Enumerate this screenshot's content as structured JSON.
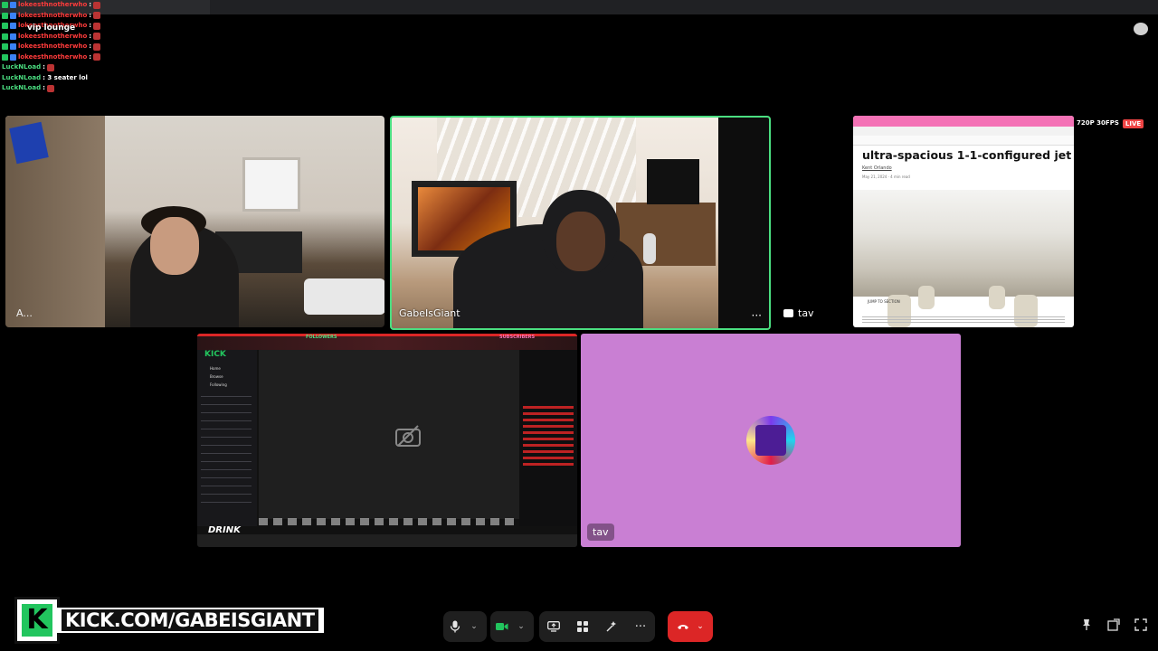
{
  "chat": {
    "lines": [
      {
        "user": "lokeesthnotherwho",
        "msg": ":"
      },
      {
        "user": "lokeesthnotherwho",
        "msg": ":"
      },
      {
        "user": "lokeesthnotherwho",
        "msg": ":"
      },
      {
        "user": "lokeesthnotherwho",
        "msg": ":"
      },
      {
        "user": "lokeesthnotherwho",
        "msg": ":"
      },
      {
        "user": "lokeesthnotherwho",
        "msg": ":"
      },
      {
        "user": "LuckNLoad",
        "msg": ":"
      },
      {
        "user": "LuckNLoad",
        "msg": ": 3 seater lol"
      },
      {
        "user": "LuckNLoad",
        "msg": ":"
      }
    ],
    "vip_label": "vip lounge"
  },
  "participants": {
    "tile_a": {
      "name": "A..."
    },
    "tile_b": {
      "name": "GabeIsGiant",
      "more": "···"
    },
    "tav_side": {
      "name": "tav"
    },
    "tile_e": {
      "name": "tav"
    }
  },
  "screenshare_article": {
    "headline": "ultra-spacious 1-1-configured jet",
    "author": "Kent Orlando",
    "date": "May 21, 2024 · 4 min read",
    "jump": "JUMP TO SECTION"
  },
  "stream_badges": {
    "resolution": "720P 30FPS",
    "live": "LIVE"
  },
  "screenshare_kick": {
    "brand": "KICK",
    "followers": "FOLLOWERS",
    "subscribers": "SUBSCRIBERS",
    "nav": [
      "Home",
      "Browse",
      "Following"
    ],
    "drink": "DRINK"
  },
  "banner": {
    "logo_letter": "K",
    "url": "KICK.COM/GABEISGIANT"
  },
  "controls": {
    "mic": "mic-icon",
    "camera": "camera-icon",
    "share": "share-screen-icon",
    "apps": "apps-icon",
    "effects": "effects-icon",
    "more": "···"
  },
  "colors": {
    "accent_green": "#4ade80",
    "hangup": "#dc2626",
    "tav_tile": "#c97fd3",
    "kick_green": "#22c55e"
  }
}
